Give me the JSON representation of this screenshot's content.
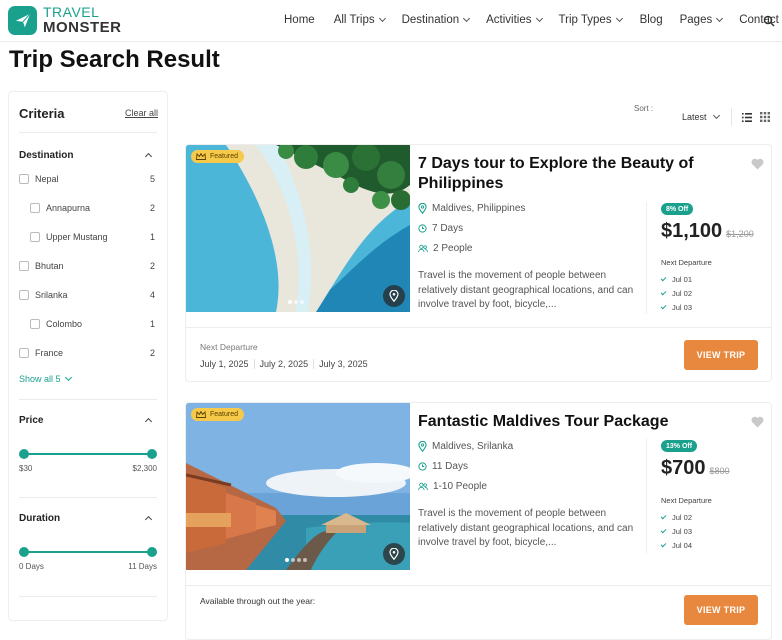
{
  "header": {
    "logo_line1": "TRAVEL",
    "logo_line2": "MONSTER",
    "nav": [
      {
        "label": "Home",
        "dropdown": false
      },
      {
        "label": "All Trips",
        "dropdown": true
      },
      {
        "label": "Destination",
        "dropdown": true
      },
      {
        "label": "Activities",
        "dropdown": true
      },
      {
        "label": "Trip Types",
        "dropdown": true
      },
      {
        "label": "Blog",
        "dropdown": false
      },
      {
        "label": "Pages",
        "dropdown": true
      },
      {
        "label": "Contact",
        "dropdown": false
      }
    ],
    "search_icon": "search-icon"
  },
  "page_title": "Trip Search Result",
  "sidebar": {
    "heading": "Criteria",
    "clear_all": "Clear all",
    "destination": {
      "title": "Destination",
      "items": [
        {
          "label": "Nepal",
          "count": "5",
          "indent": false
        },
        {
          "label": "Annapurna",
          "count": "2",
          "indent": true
        },
        {
          "label": "Upper Mustang",
          "count": "1",
          "indent": true
        },
        {
          "label": "Bhutan",
          "count": "2",
          "indent": false
        },
        {
          "label": "Srilanka",
          "count": "4",
          "indent": false
        },
        {
          "label": "Colombo",
          "count": "1",
          "indent": true
        },
        {
          "label": "France",
          "count": "2",
          "indent": false
        }
      ],
      "show_all": "Show all 5"
    },
    "price": {
      "title": "Price",
      "min": "$30",
      "max": "$2,300"
    },
    "duration": {
      "title": "Duration",
      "min": "0 Days",
      "max": "11 Days"
    }
  },
  "sort": {
    "label": "Sort :",
    "value": "Latest"
  },
  "trips": [
    {
      "featured": "Featured",
      "title": "7 Days tour to Explore the Beauty of Philippines",
      "location": "Maldives, Philippines",
      "duration": "7 Days",
      "people": "2 People",
      "description": "Travel is the movement of people between relatively distant geographical locations, and can involve travel by foot, bicycle,...",
      "discount": "8% Off",
      "price": "$1,100",
      "old_price": "$1,200",
      "next_departure_label": "Next Departure",
      "departures": [
        "Jul 01",
        "Jul 02",
        "Jul 03"
      ],
      "footer_label": "Next Departure",
      "footer_dates": [
        "July 1, 2025",
        "July 2, 2025",
        "July 3, 2025"
      ],
      "button": "VIEW TRIP"
    },
    {
      "featured": "Featured",
      "title": "Fantastic Maldives Tour Package",
      "location": "Maldives, Srilanka",
      "duration": "11 Days",
      "people": "1-10 People",
      "description": "Travel is the movement of people between relatively distant geographical locations, and can involve travel by foot, bicycle,...",
      "discount": "13% Off",
      "price": "$700",
      "old_price": "$800",
      "next_departure_label": "Next Departure",
      "departures": [
        "Jul 02",
        "Jul 03",
        "Jul 04"
      ],
      "footer_label": "Available through out the year:",
      "footer_dates": [],
      "button": "VIEW TRIP"
    }
  ],
  "colors": {
    "accent": "#1aa18e",
    "button": "#e8883f",
    "featured": "#f7c94a"
  }
}
